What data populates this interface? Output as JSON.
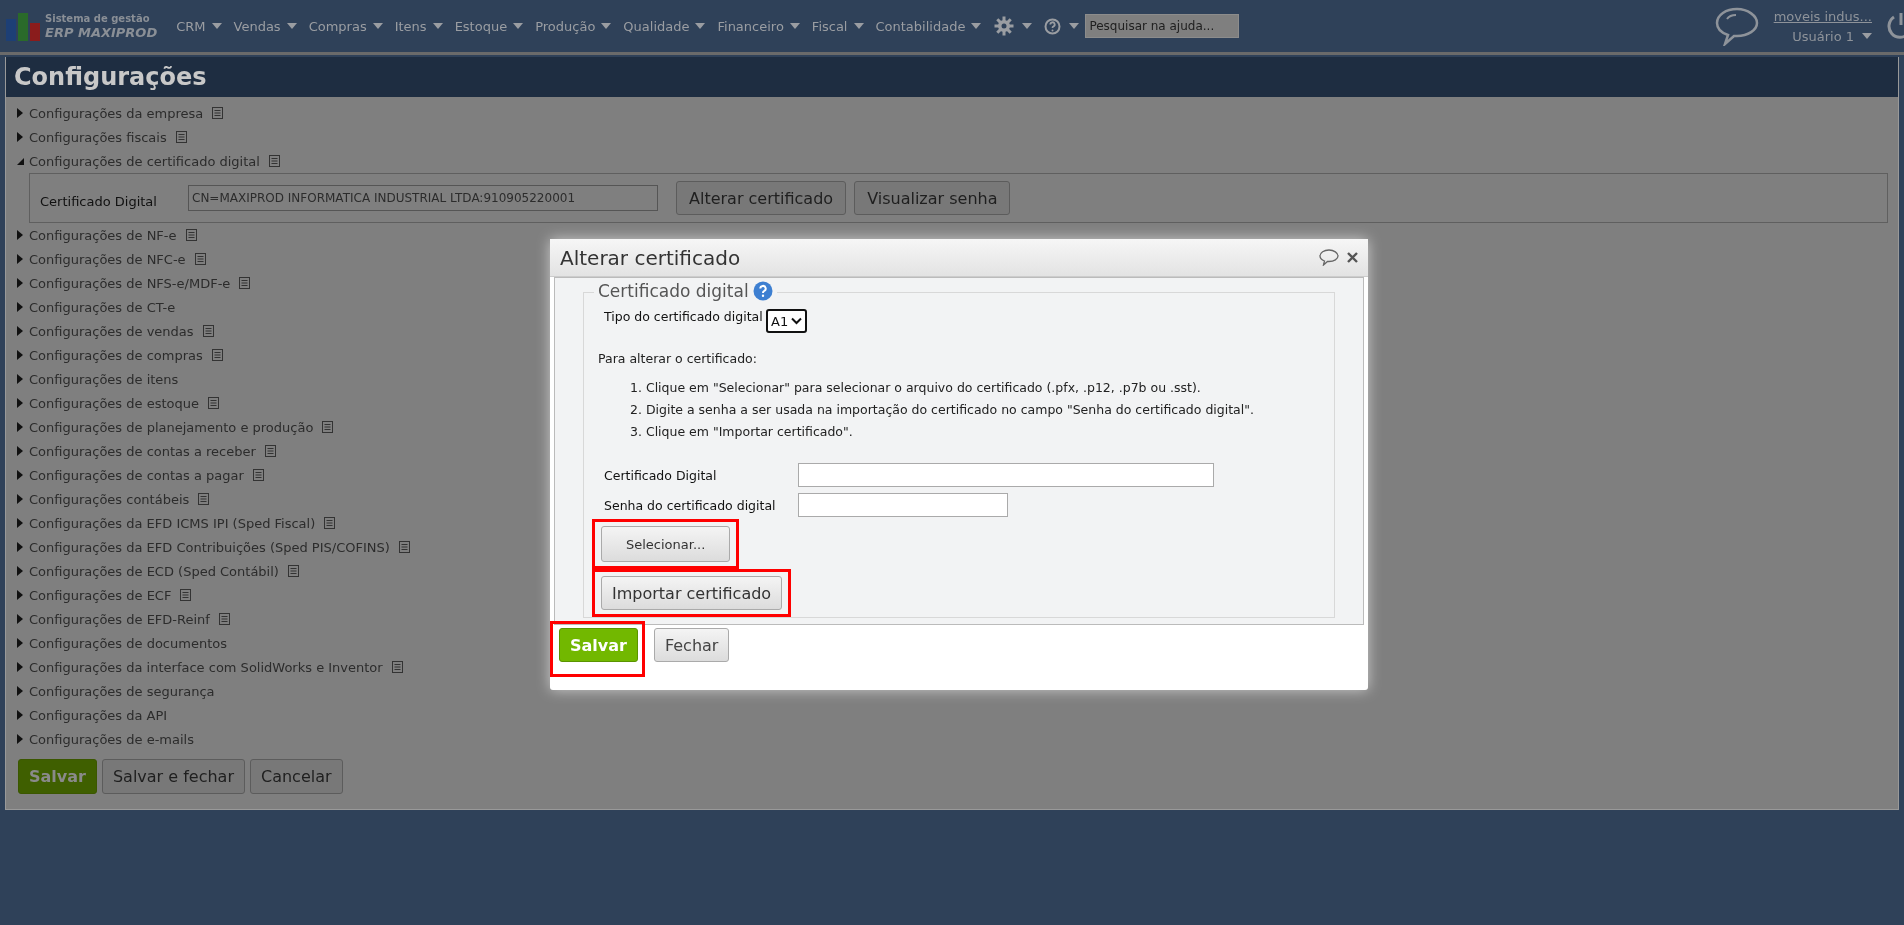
{
  "logo": {
    "subtitle": "Sistema de gestão",
    "title": "ERP MAXIPROD"
  },
  "menu": [
    {
      "label": "CRM"
    },
    {
      "label": "Vendas"
    },
    {
      "label": "Compras"
    },
    {
      "label": "Itens"
    },
    {
      "label": "Estoque"
    },
    {
      "label": "Produção"
    },
    {
      "label": "Qualidade"
    },
    {
      "label": "Financeiro"
    },
    {
      "label": "Fiscal"
    },
    {
      "label": "Contabilidade"
    }
  ],
  "help_search": {
    "placeholder": "Pesquisar na ajuda..."
  },
  "user": {
    "company": "moveis indus...",
    "name": "Usuário 1"
  },
  "page_title": "Configurações",
  "sections": [
    {
      "label": "Configurações da empresa",
      "expanded": false,
      "note_icon": true
    },
    {
      "label": "Configurações fiscais",
      "expanded": false,
      "note_icon": true
    },
    {
      "label": "Configurações de certificado digital",
      "expanded": true,
      "note_icon": true,
      "field": {
        "label": "Certificado Digital",
        "value": "CN=MAXIPROD INFORMATICA INDUSTRIAL LTDA:910905220001"
      },
      "buttons": [
        "Alterar certificado",
        "Visualizar senha"
      ]
    },
    {
      "label": "Configurações de NF-e",
      "expanded": false,
      "note_icon": true
    },
    {
      "label": "Configurações de NFC-e",
      "expanded": false,
      "note_icon": true
    },
    {
      "label": "Configurações de NFS-e/MDF-e",
      "expanded": false,
      "note_icon": true
    },
    {
      "label": "Configurações de CT-e",
      "expanded": false,
      "note_icon": false
    },
    {
      "label": "Configurações de vendas",
      "expanded": false,
      "note_icon": true
    },
    {
      "label": "Configurações de compras",
      "expanded": false,
      "note_icon": true
    },
    {
      "label": "Configurações de itens",
      "expanded": false,
      "note_icon": false
    },
    {
      "label": "Configurações de estoque",
      "expanded": false,
      "note_icon": true
    },
    {
      "label": "Configurações de planejamento e produção",
      "expanded": false,
      "note_icon": true
    },
    {
      "label": "Configurações de contas a receber",
      "expanded": false,
      "note_icon": true
    },
    {
      "label": "Configurações de contas a pagar",
      "expanded": false,
      "note_icon": true
    },
    {
      "label": "Configurações contábeis",
      "expanded": false,
      "note_icon": true
    },
    {
      "label": "Configurações da EFD ICMS IPI (Sped Fiscal)",
      "expanded": false,
      "note_icon": true
    },
    {
      "label": "Configurações da EFD Contribuições (Sped PIS/COFINS)",
      "expanded": false,
      "note_icon": true
    },
    {
      "label": "Configurações de ECD (Sped Contábil)",
      "expanded": false,
      "note_icon": true
    },
    {
      "label": "Configurações de ECF",
      "expanded": false,
      "note_icon": true
    },
    {
      "label": "Configurações de EFD-Reinf",
      "expanded": false,
      "note_icon": true
    },
    {
      "label": "Configurações de documentos",
      "expanded": false,
      "note_icon": false
    },
    {
      "label": "Configurações da interface com SolidWorks e Inventor",
      "expanded": false,
      "note_icon": true
    },
    {
      "label": "Configurações de segurança",
      "expanded": false,
      "note_icon": false
    },
    {
      "label": "Configurações da API",
      "expanded": false,
      "note_icon": false
    },
    {
      "label": "Configurações de e-mails",
      "expanded": false,
      "note_icon": false
    }
  ],
  "page_buttons": [
    {
      "label": "Salvar",
      "kind": "primary"
    },
    {
      "label": "Salvar e fechar",
      "kind": "default"
    },
    {
      "label": "Cancelar",
      "kind": "default"
    }
  ],
  "dialog": {
    "title": "Alterar certificado",
    "legend": "Certificado digital",
    "type_field": {
      "label": "Tipo do certificado digital",
      "value": "A1"
    },
    "intro": "Para alterar o certificado:",
    "steps": [
      "1. Clique em \"Selecionar\" para selecionar o arquivo do certificado (.pfx, .p12, .p7b ou .sst).",
      "2. Digite a senha a ser usada na importação do certificado no campo \"Senha do certificado digital\".",
      "3. Clique em \"Importar certificado\"."
    ],
    "fields": [
      {
        "label": "Certificado Digital",
        "kind": "wide"
      },
      {
        "label": "Senha do certificado digital",
        "kind": "narrow"
      }
    ],
    "actions": [
      {
        "label": "Selecionar...",
        "kind": "small",
        "highlighted": true
      },
      {
        "label": "Importar certificado",
        "kind": "large",
        "highlighted": true
      }
    ],
    "footer_buttons": [
      {
        "label": "Salvar",
        "kind": "primary",
        "highlighted": true
      },
      {
        "label": "Fechar",
        "kind": "default",
        "highlighted": false
      }
    ]
  }
}
